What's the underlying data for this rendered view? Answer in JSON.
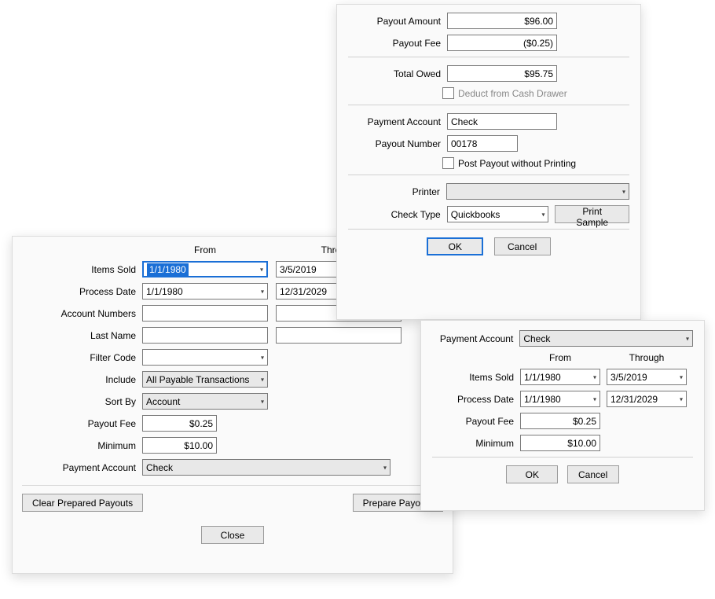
{
  "panel_a": {
    "headers": {
      "from": "From",
      "through": "Through"
    },
    "items_sold": {
      "label": "Items Sold",
      "from": "1/1/1980",
      "through": "3/5/2019"
    },
    "process_date": {
      "label": "Process Date",
      "from": "1/1/1980",
      "through": "12/31/2029"
    },
    "account_numbers": {
      "label": "Account Numbers",
      "from": "",
      "through": ""
    },
    "last_name": {
      "label": "Last Name",
      "from": "",
      "through": ""
    },
    "filter_code": {
      "label": "Filter Code",
      "value": ""
    },
    "include": {
      "label": "Include",
      "value": "All Payable Transactions"
    },
    "sort_by": {
      "label": "Sort By",
      "value": "Account"
    },
    "payout_fee": {
      "label": "Payout Fee",
      "value": "$0.25"
    },
    "minimum": {
      "label": "Minimum",
      "value": "$10.00"
    },
    "payment_account": {
      "label": "Payment Account",
      "value": "Check"
    },
    "buttons": {
      "clear": "Clear Prepared Payouts",
      "prepare": "Prepare Payouts",
      "close": "Close"
    }
  },
  "panel_b": {
    "payout_amount": {
      "label": "Payout Amount",
      "value": "$96.00"
    },
    "payout_fee": {
      "label": "Payout Fee",
      "value": "($0.25)"
    },
    "total_owed": {
      "label": "Total Owed",
      "value": "$95.75"
    },
    "deduct_drawer": {
      "label": "Deduct from Cash Drawer",
      "checked": false
    },
    "payment_account": {
      "label": "Payment Account",
      "value": "Check"
    },
    "payout_number": {
      "label": "Payout Number",
      "value": "00178"
    },
    "post_without_print": {
      "label": "Post Payout without Printing",
      "checked": false
    },
    "printer": {
      "label": "Printer",
      "value": ""
    },
    "check_type": {
      "label": "Check Type",
      "value": "Quickbooks"
    },
    "buttons": {
      "print_sample": "Print Sample",
      "ok": "OK",
      "cancel": "Cancel"
    }
  },
  "panel_c": {
    "payment_account": {
      "label": "Payment Account",
      "value": "Check"
    },
    "headers": {
      "from": "From",
      "through": "Through"
    },
    "items_sold": {
      "label": "Items Sold",
      "from": "1/1/1980",
      "through": "3/5/2019"
    },
    "process_date": {
      "label": "Process Date",
      "from": "1/1/1980",
      "through": "12/31/2029"
    },
    "payout_fee": {
      "label": "Payout Fee",
      "value": "$0.25"
    },
    "minimum": {
      "label": "Minimum",
      "value": "$10.00"
    },
    "buttons": {
      "ok": "OK",
      "cancel": "Cancel"
    }
  }
}
